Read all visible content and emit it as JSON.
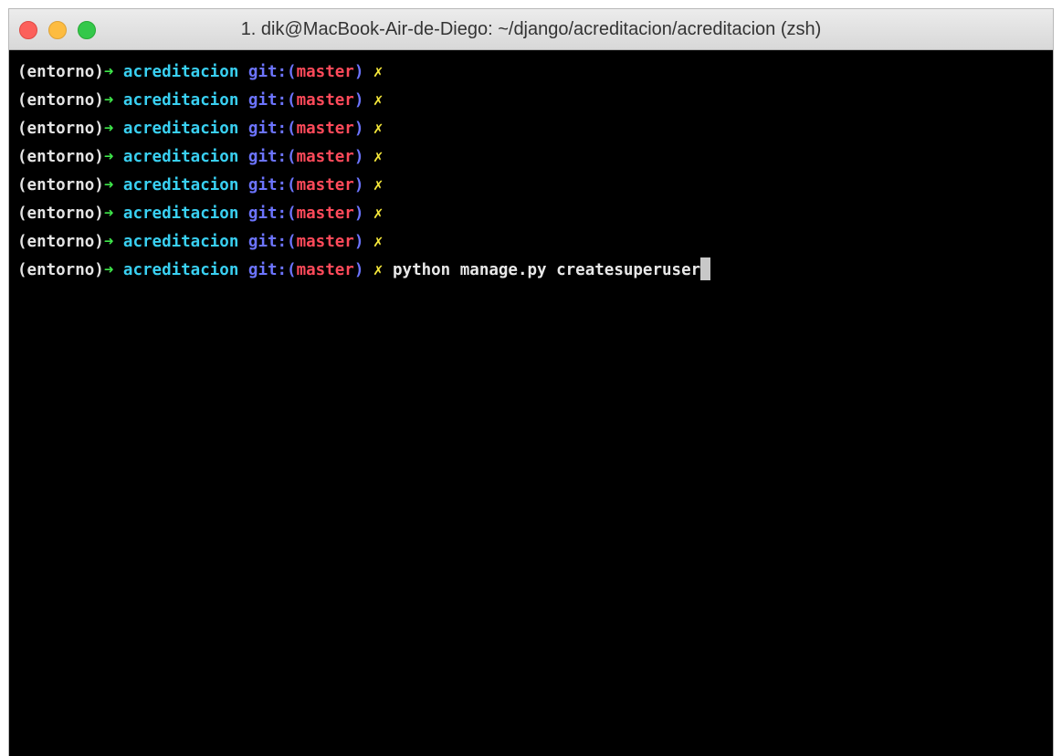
{
  "window": {
    "title": "1. dik@MacBook-Air-de-Diego: ~/django/acreditacion/acreditacion (zsh)"
  },
  "prompt": {
    "env": "(entorno)",
    "arrow": "➜",
    "directory": "acreditacion",
    "git_prefix": "git:(",
    "branch": "master",
    "git_suffix": ")",
    "dirty_marker": "✗"
  },
  "lines": [
    {
      "command": ""
    },
    {
      "command": ""
    },
    {
      "command": ""
    },
    {
      "command": ""
    },
    {
      "command": ""
    },
    {
      "command": ""
    },
    {
      "command": ""
    },
    {
      "command": "python manage.py createsuperuser"
    }
  ],
  "colors": {
    "background": "#000000",
    "arrow": "#3ee64a",
    "directory": "#39d0f2",
    "git": "#6c74ff",
    "branch": "#ff4a5a",
    "dirty": "#f6e83a",
    "traffic_close": "#fc605b",
    "traffic_minimize": "#fdbc40",
    "traffic_maximize": "#34c84a"
  }
}
